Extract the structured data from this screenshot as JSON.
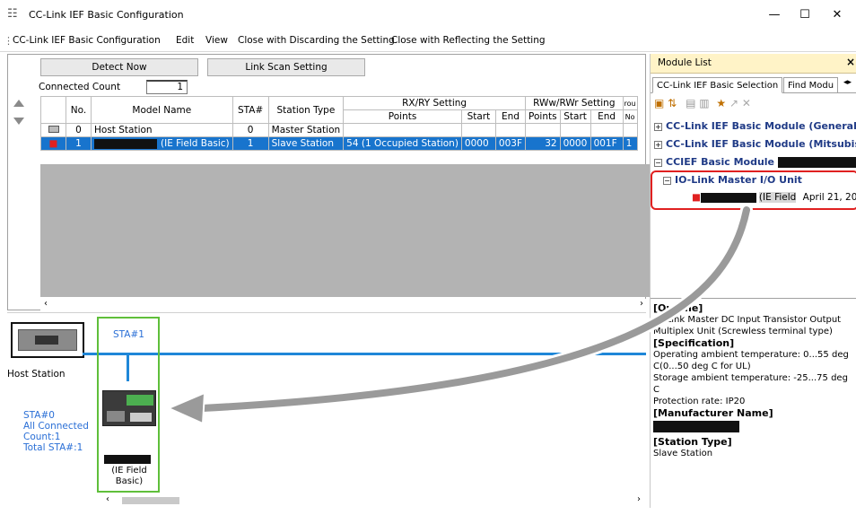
{
  "window": {
    "title": "CC-Link IEF Basic Configuration",
    "minimize": "—",
    "maximize": "☐",
    "close": "✕"
  },
  "menu": {
    "items": [
      "CC-Link IEF Basic Configuration",
      "Edit",
      "View",
      "Close with Discarding the Setting",
      "Close with Reflecting the Setting"
    ]
  },
  "toolbar": {
    "detect_now": "Detect Now",
    "link_scan_setting": "Link Scan Setting",
    "connected_count_label": "Connected Count",
    "connected_count_value": "1"
  },
  "table": {
    "headers": {
      "no": "No.",
      "model_name": "Model Name",
      "sta": "STA#",
      "station_type": "Station Type",
      "rxry": "RX/RY Setting",
      "rxry_points": "Points",
      "rxry_start": "Start",
      "rxry_end": "End",
      "rww": "RWw/RWr Setting",
      "rww_points": "Points",
      "rww_start": "Start",
      "rww_end": "End",
      "group_top": "rou",
      "group_bottom": "No"
    },
    "rows": [
      {
        "no": "0",
        "model_name": "Host Station",
        "sta": "0",
        "station_type": "Master Station",
        "rx_points": "",
        "rx_start": "",
        "rx_end": "",
        "rw_points": "",
        "rw_start": "",
        "rw_end": "",
        "group": ""
      },
      {
        "no": "1",
        "model_name": "(IE Field Basic)",
        "sta": "1",
        "station_type": "Slave Station",
        "rx_points": "54 (1 Occupied Station)",
        "rx_start": "0000",
        "rx_end": "003F",
        "rw_points": "32",
        "rw_start": "0000",
        "rw_end": "001F",
        "group": "1"
      }
    ]
  },
  "network": {
    "host_label": "Host Station",
    "sta_header": "STA#1",
    "summary_line1": "STA#0",
    "summary_line2": "All Connected",
    "summary_line3": "Count:1",
    "summary_line4": "Total STA#:1",
    "device_label_line1": "(IE Field",
    "device_label_line2": "Basic)"
  },
  "module_list": {
    "title": "Module List",
    "close": "×",
    "tab1": "CC-Link IEF Basic Selection",
    "tab2": "Find Modu",
    "tree": {
      "general": "CC-Link IEF Basic Module (General)",
      "mitsubishi": "CC-Link IEF Basic Module (Mitsubish",
      "cciief": "CCIEF Basic Module",
      "iolink": "IO-Link Master I/O Unit",
      "device_name": "(IE Field",
      "device_date": "April 21, 20"
    }
  },
  "outline": {
    "outline_head": "[Outline]",
    "outline_text": "IO-Link Master DC Input Transistor Output Multiplex Unit (Screwless terminal type)",
    "spec_head": "[Specification]",
    "spec_text1": "Operating ambient temperature: 0...55 deg C(0...50 deg C for UL)",
    "spec_text2": "Storage ambient temperature: -25...75 deg C",
    "spec_text3": "Protection rate: IP20",
    "mfr_head": "[Manufacturer Name]",
    "type_head": "[Station Type]",
    "type_text": "Slave Station"
  },
  "colors": {
    "selection": "#1874cd",
    "grid_empty": "#b3b3b3",
    "network_line": "#1f87d8",
    "station_text": "#2a6fd6",
    "highlight_green": "#5fbf3a",
    "callout_red": "#e02020",
    "arrow_gray": "#9a9a9a",
    "tree_text": "#1f3a86",
    "module_header": "#fff3c7"
  }
}
